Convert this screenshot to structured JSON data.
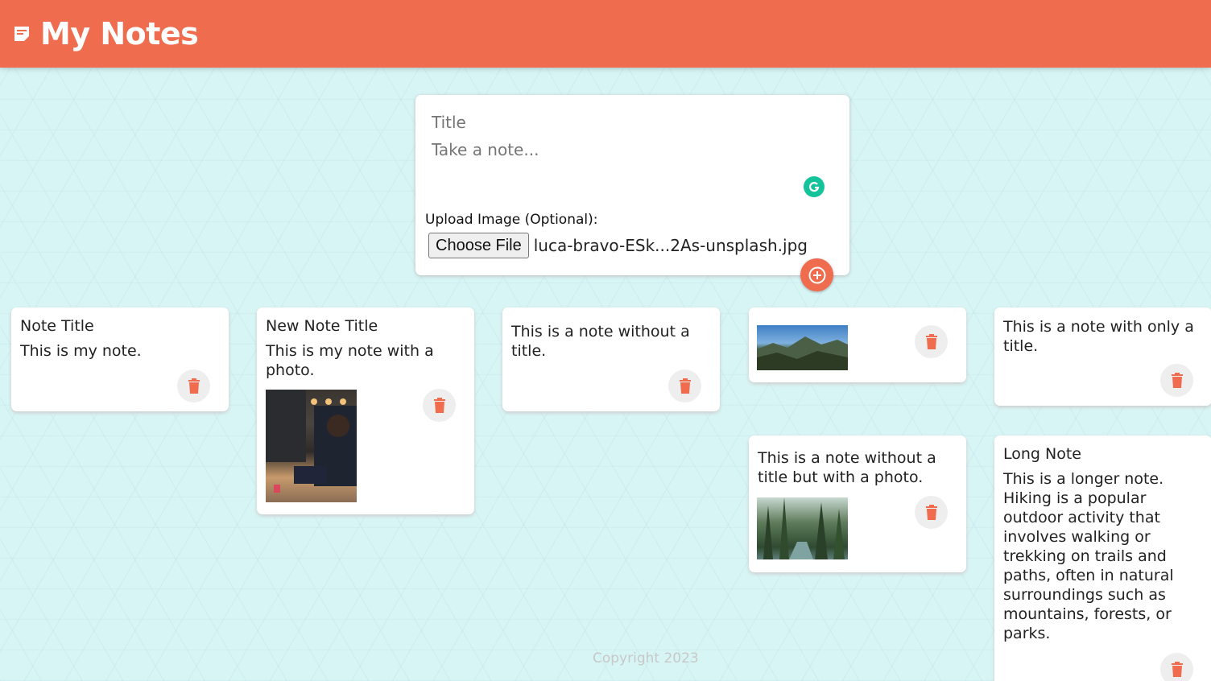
{
  "header": {
    "title": "My Notes",
    "icon": "sticky-note-icon"
  },
  "composer": {
    "title_placeholder": "Title",
    "content_placeholder": "Take a note...",
    "upload_label": "Upload Image (Optional):",
    "choose_file_label": "Choose File",
    "file_name": "luca-bravo-ESk...2As-unsplash.jpg",
    "add_icon": "add-circle-icon"
  },
  "notes": [
    {
      "title": "Note Title",
      "content": "This is my note."
    },
    {
      "title": "New Note Title",
      "content": "This is my note with a photo."
    },
    {
      "title": "",
      "content": "This is a note without a title."
    },
    {
      "title": "",
      "content": ""
    },
    {
      "title": "",
      "content": "This is a note with only a title."
    },
    {
      "title": "",
      "content": "This is a note without a title but with a photo."
    },
    {
      "title": "Long Note",
      "content": "This is a longer note. Hiking is a popular outdoor activity that involves walking or trekking on trails and paths, often in natural surroundings such as mountains, forests, or parks."
    }
  ],
  "footer": {
    "copyright": "Copyright 2023"
  },
  "colors": {
    "accent": "#ef6c4f",
    "background": "#d8f5f5",
    "card": "#ffffff",
    "delete_bg": "#eeeeee"
  }
}
